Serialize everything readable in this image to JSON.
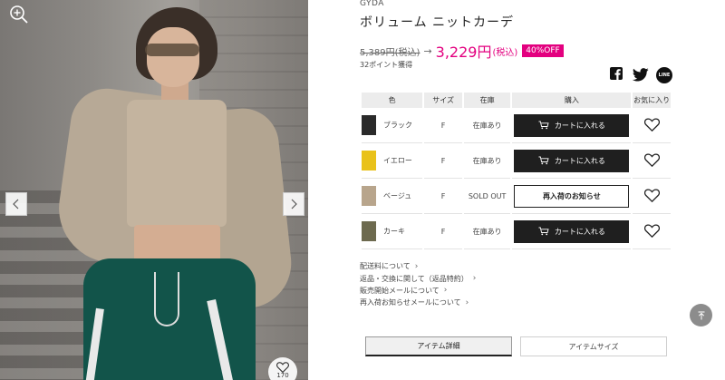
{
  "photo": {
    "favorite_count": "170"
  },
  "product": {
    "brand": "GYDA",
    "name": "ボリューム ニットカーデ",
    "old_price": "5,389円(税込)",
    "arrow": "→",
    "new_price": "3,229円",
    "new_price_tax": "(税込)",
    "discount": "40%OFF",
    "points": "32ポイント獲得",
    "accent_color": "#e3007f"
  },
  "share": {
    "icons": [
      "facebook-icon",
      "twitter-icon",
      "line-icon"
    ],
    "line_label": "LINE"
  },
  "stock_table": {
    "headers": {
      "color": "色",
      "size": "サイズ",
      "stock": "在庫",
      "purchase": "購入",
      "favorite": "お気に入り"
    },
    "rows": [
      {
        "color": "ブラック",
        "size": "F",
        "stock": "在庫あり",
        "action": "カートに入れる",
        "swatch": "#2a2a2a"
      },
      {
        "color": "イエロー",
        "size": "F",
        "stock": "在庫あり",
        "action": "カートに入れる",
        "swatch": "#e9c21a"
      },
      {
        "color": "ベージュ",
        "size": "F",
        "stock": "SOLD OUT",
        "action": "再入荷のお知らせ",
        "swatch": "#b8a58c"
      },
      {
        "color": "カーキ",
        "size": "F",
        "stock": "在庫あり",
        "action": "カートに入れる",
        "swatch": "#6d6a4f"
      }
    ]
  },
  "links": [
    "配送料について",
    "返品・交換に関して（返品特約）",
    "販売開始メールについて",
    "再入荷お知らせメールについて"
  ],
  "tabs": [
    {
      "label": "アイテム詳細",
      "active": true
    },
    {
      "label": "アイテムサイズ",
      "active": false
    }
  ]
}
